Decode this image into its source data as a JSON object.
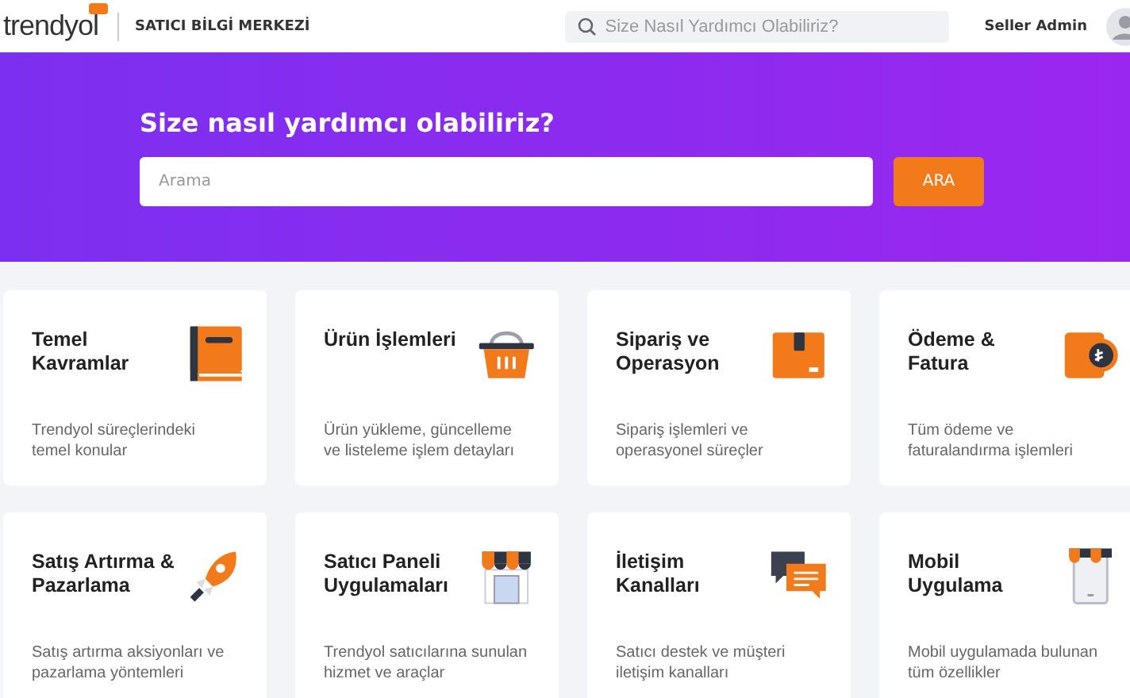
{
  "header": {
    "logo": "trendyol",
    "section_title": "SATICI BİLGİ MERKEZİ",
    "search": {
      "placeholder": "Size Nasıl Yardımcı Olabiliriz?"
    },
    "user_name": "Seller Admin"
  },
  "hero": {
    "title": "Size nasıl yardımcı olabiliriz?",
    "search": {
      "placeholder": "Arama"
    },
    "button": "ARA"
  },
  "cards": [
    {
      "title": "Temel Kavramlar",
      "description": "Trendyol süreçlerindeki temel konular",
      "kind": "book"
    },
    {
      "title": "Ürün İşlemleri",
      "description": "Ürün yükleme, güncelleme ve listeleme işlem detayları",
      "kind": "basket"
    },
    {
      "title": "Sipariş ve Operasyon",
      "description": "Sipariş işlemleri ve operasyonel süreçler",
      "kind": "box"
    },
    {
      "title": "Ödeme & Fatura",
      "description": "Tüm ödeme ve faturalandırma işlemleri",
      "kind": "coin"
    },
    {
      "title": "Satış Artırma & Pazarlama",
      "description": "Satış artırma aksiyonları ve pazarlama yöntemleri",
      "kind": "rocket"
    },
    {
      "title": "Satıcı Paneli Uygulamaları",
      "description": "Trendyol satıcılarına sunulan hizmet ve araçlar",
      "kind": "store"
    },
    {
      "title": "İletişim Kanalları",
      "description": "Satıcı destek ve müşteri iletişim kanalları",
      "kind": "chat"
    },
    {
      "title": "Mobil Uygulama",
      "description": "Mobil uygulamada bulunan tüm özellikler",
      "kind": "phone"
    }
  ]
}
